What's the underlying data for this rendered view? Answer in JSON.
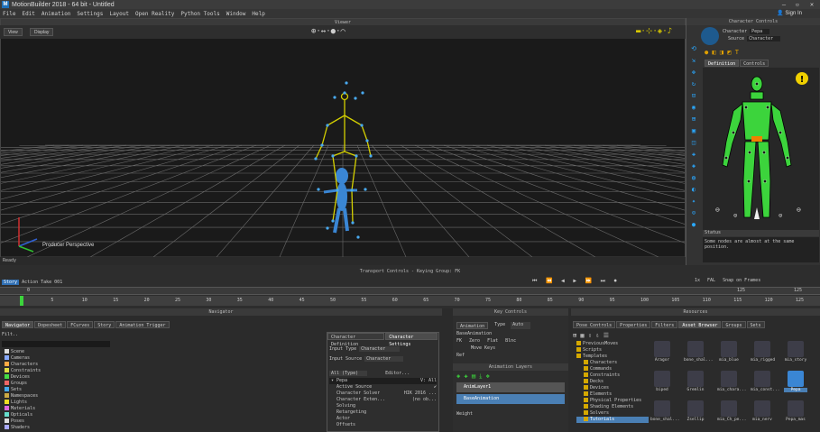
{
  "app": {
    "title": "MotionBuilder 2018 - 64 bit - Untitled",
    "sign_in": "Sign In"
  },
  "menu": [
    "File",
    "Edit",
    "Animation",
    "Settings",
    "Layout",
    "Open Reality",
    "Python Tools",
    "Window",
    "Help"
  ],
  "viewer": {
    "title": "Viewer",
    "view_btn": "View",
    "display_btn": "Display",
    "camera_label": "Producer Perspective",
    "status": "Ready"
  },
  "character_controls": {
    "title": "Character Controls",
    "character_label": "Character",
    "character_value": "Pepa",
    "source_label": "Source",
    "source_value": "Character",
    "tab_definition": "Definition",
    "tab_controls": "Controls",
    "status_title": "Status",
    "status_text": "Some nodes are almost at the same position.",
    "warning_glyph": "!"
  },
  "transport": {
    "title": "Transport Controls - Keying Group: FK",
    "mode": "Story",
    "action": "Action",
    "take": "Take 001",
    "snap": "Snap on Frames",
    "fps": "FAL",
    "speed": "1x",
    "frame_start": "0",
    "frame_end": "125",
    "ruler_ticks": [
      "0",
      "5",
      "10",
      "15",
      "20",
      "25",
      "30",
      "35",
      "40",
      "45",
      "50",
      "55",
      "60",
      "65",
      "70",
      "75",
      "80",
      "85",
      "90",
      "95",
      "100",
      "105",
      "110",
      "115",
      "120",
      "125"
    ],
    "range_start": "0",
    "range_end": "125",
    "range_end2": "125"
  },
  "navigator": {
    "title": "Navigator",
    "tabs": [
      "Navigator",
      "Dopesheet",
      "FCurves",
      "Story",
      "Animation Trigger"
    ],
    "filter": "Filt..",
    "items": [
      "Scene",
      "Cameras",
      "Characters",
      "Constraints",
      "Devices",
      "Groups",
      "Sets",
      "Namespaces",
      "Lights",
      "Materials",
      "Opticals",
      "Poses",
      "Shaders"
    ]
  },
  "char_settings": {
    "tabs": [
      "Character Definition",
      "Character Settings"
    ],
    "input_type_label": "Input Type",
    "input_type": "Character",
    "input_source_label": "Input Source",
    "input_source": "Character",
    "filter": "All (Type)",
    "editor": "Editor...",
    "props": [
      {
        "name": "Pepa",
        "value": "V: All"
      },
      {
        "name": "Active Source",
        "value": "✔"
      },
      {
        "name": "Character Solver",
        "value": "HIK 2016 ..."
      },
      {
        "name": "Character Exten...",
        "value": "(no ob..."
      },
      {
        "name": "Solving",
        "value": ""
      },
      {
        "name": "Retargeting",
        "value": ""
      },
      {
        "name": "Actor",
        "value": ""
      },
      {
        "name": "Offsets",
        "value": ""
      }
    ]
  },
  "key_controls": {
    "title": "Key Controls",
    "animation": "Animation",
    "type_label": "Type",
    "type_value": "Auto",
    "layer": "BaseAnimation",
    "fk": "FK",
    "zero": "Zero",
    "flat": "Flat",
    "blend": "Blnc",
    "move_keys": "Move Keys",
    "ref": "Ref",
    "layers_title": "Animation Layers",
    "layers": [
      "AnimLayer1",
      "BaseAnimation"
    ],
    "weight_label": "Weight"
  },
  "resources": {
    "title": "Resources",
    "tabs": [
      "Pose Controls",
      "Properties",
      "Filters",
      "Asset Browser",
      "Groups",
      "Sets"
    ],
    "tree": [
      "PreviousMoves",
      "Scripts",
      "Templates",
      "Characters",
      "Commands",
      "Constraints",
      "Decks",
      "Devices",
      "Elements",
      "Physical Properties",
      "Shading Elements",
      "Solvers",
      "Tutorials"
    ],
    "assets_row1": [
      "Aragor",
      "bone_shal...",
      "mia_blue",
      "mia_rigged",
      "mia_story"
    ],
    "assets_row2": [
      "biped",
      "Gremlin",
      "mia_chara...",
      "mia_const...",
      "Pepa"
    ],
    "assets_row3": [
      "bone_shal...",
      "Zsellip",
      "mia_Ch_pe...",
      "mia_nerv",
      "Pepa_mas"
    ]
  },
  "colors": {
    "accent": "#1e6fb8",
    "skeleton_yellow": "#d4d000",
    "body_green": "#3cd43c",
    "pepa_blue": "#3a86d4"
  }
}
